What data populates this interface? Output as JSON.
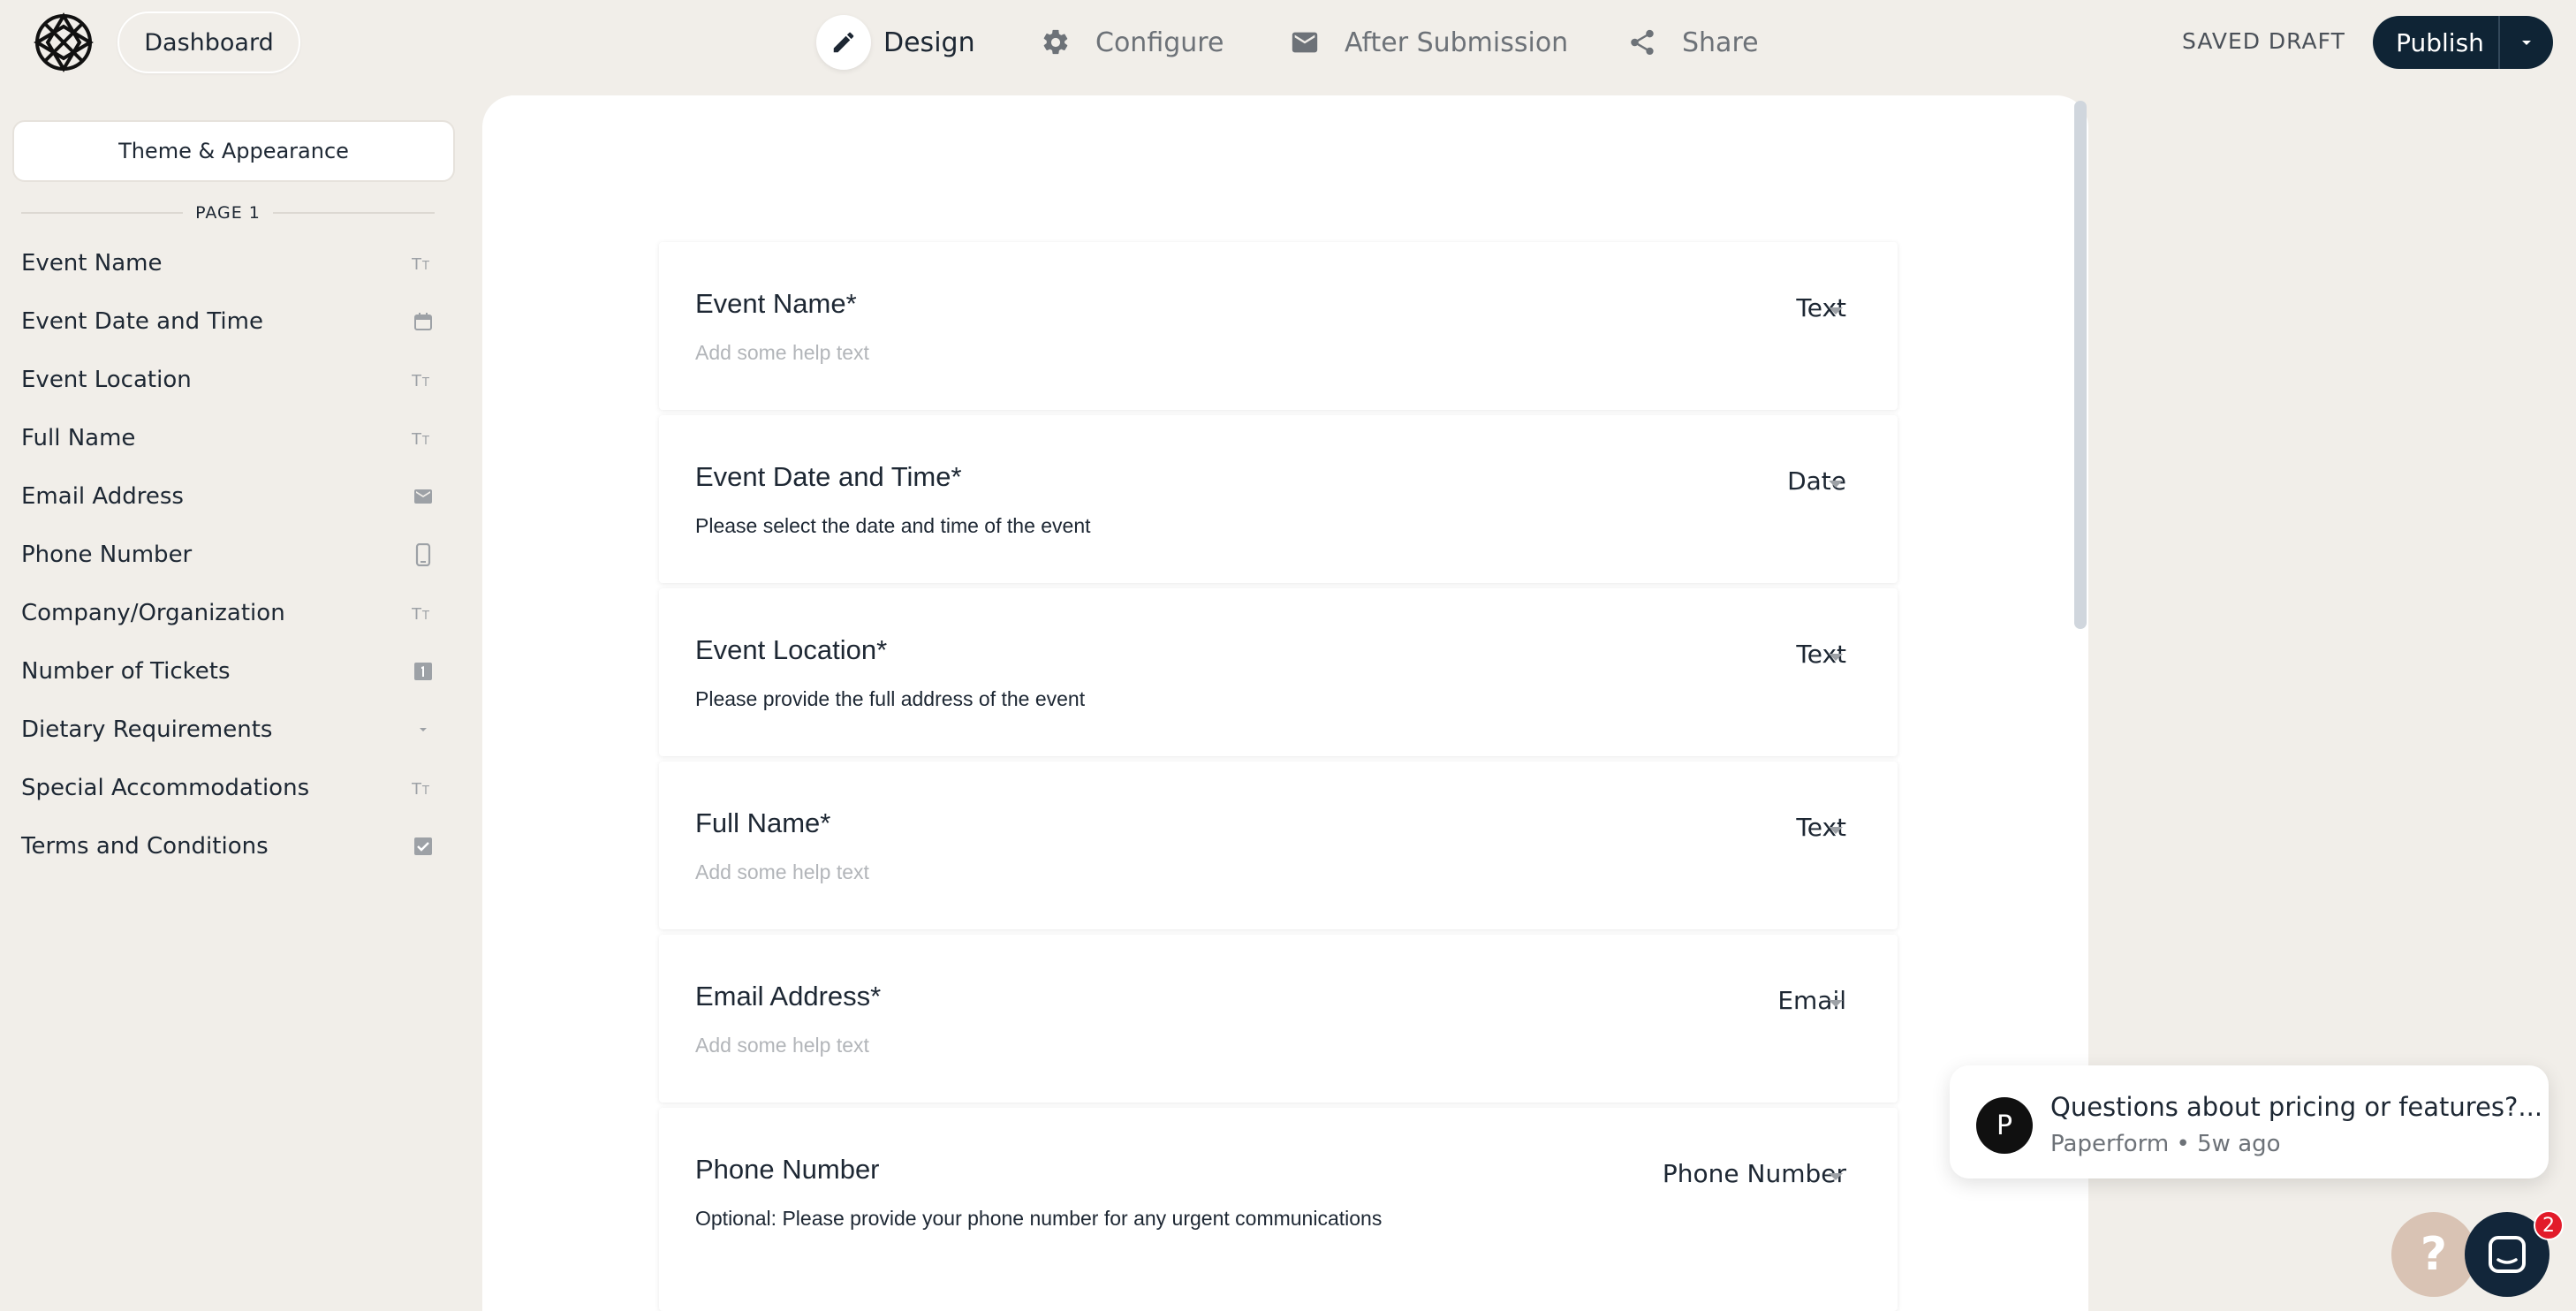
{
  "header": {
    "dashboard_label": "Dashboard",
    "nav": [
      {
        "label": "Design",
        "icon": "pencil-icon",
        "active": true
      },
      {
        "label": "Configure",
        "icon": "gear-icon",
        "active": false
      },
      {
        "label": "After Submission",
        "icon": "envelope-icon",
        "active": false
      },
      {
        "label": "Share",
        "icon": "share-icon",
        "active": false
      }
    ],
    "status": "SAVED DRAFT",
    "publish_label": "Publish"
  },
  "sidebar": {
    "theme_label": "Theme & Appearance",
    "page_label": "PAGE 1",
    "items": [
      {
        "label": "Event Name",
        "icon": "text-icon"
      },
      {
        "label": "Event Date and Time",
        "icon": "calendar-icon"
      },
      {
        "label": "Event Location",
        "icon": "text-icon"
      },
      {
        "label": "Full Name",
        "icon": "text-icon"
      },
      {
        "label": "Email Address",
        "icon": "envelope-icon"
      },
      {
        "label": "Phone Number",
        "icon": "phone-icon"
      },
      {
        "label": "Company/Organization",
        "icon": "text-icon"
      },
      {
        "label": "Number of Tickets",
        "icon": "number-icon"
      },
      {
        "label": "Dietary Requirements",
        "icon": "dropdown-icon"
      },
      {
        "label": "Special Accommodations",
        "icon": "text-icon"
      },
      {
        "label": "Terms and Conditions",
        "icon": "checkbox-icon"
      }
    ]
  },
  "questions": [
    {
      "title": "Event Name*",
      "help": "Add some help text",
      "help_is_placeholder": true,
      "type": "Text"
    },
    {
      "title": "Event Date and Time*",
      "help": "Please select the date and time of the event",
      "help_is_placeholder": false,
      "type": "Date"
    },
    {
      "title": "Event Location*",
      "help": "Please provide the full address of the event",
      "help_is_placeholder": false,
      "type": "Text"
    },
    {
      "title": "Full Name*",
      "help": "Add some help text",
      "help_is_placeholder": true,
      "type": "Text"
    },
    {
      "title": "Email Address*",
      "help": "Add some help text",
      "help_is_placeholder": true,
      "type": "Email"
    },
    {
      "title": "Phone Number",
      "help": "Optional: Please provide your phone number for any urgent communications",
      "help_is_placeholder": false,
      "type": "Phone Number"
    }
  ],
  "chat": {
    "avatar_letter": "P",
    "message": "Questions about pricing or features?...",
    "meta": "Paperform • 5w ago",
    "help_glyph": "?",
    "badge_count": "2"
  },
  "colors": {
    "background": "#f1eee9",
    "primary_dark": "#0f2435",
    "badge_red": "#e21b2a"
  }
}
